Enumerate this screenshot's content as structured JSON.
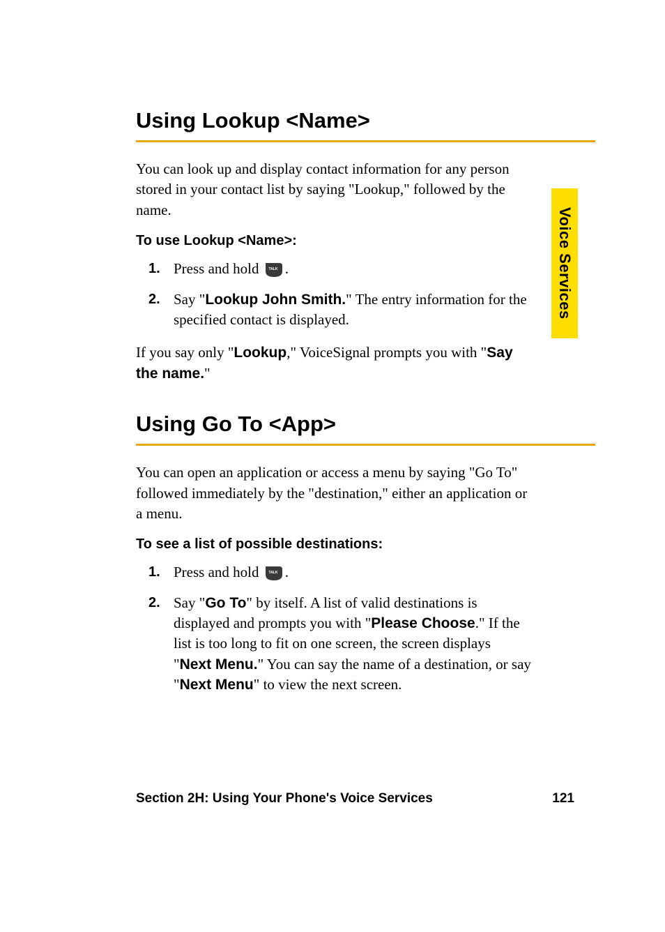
{
  "sideTab": "Voice Services",
  "sections": [
    {
      "heading": "Using Lookup <Name>",
      "intro": "You can look up and display contact information for any person stored in your contact list by saying \"Lookup,\" followed by the name.",
      "subheading": "To use Lookup <Name>:",
      "steps": {
        "step1_pre": "Press and hold ",
        "step1_post": ".",
        "step2_pre": "Say \"",
        "step2_bold": "Lookup John Smith.",
        "step2_post": "\" The entry information for the specified contact is displayed."
      },
      "after_pre": "If you say only \"",
      "after_bold1": "Lookup",
      "after_mid": ",\" VoiceSignal prompts you with \"",
      "after_bold2": "Say the name.",
      "after_post": "\""
    },
    {
      "heading": "Using Go To <App>",
      "intro": "You can open an application or access a menu by saying \"Go To\" followed immediately by the \"destination,\" either an application or a menu.",
      "subheading": "To see a list of possible destinations:",
      "steps": {
        "step1_pre": "Press and hold ",
        "step1_post": ".",
        "step2_pre": "Say \"",
        "step2_bold1": "Go To",
        "step2_mid1": "\" by itself. A list of valid destinations is displayed and prompts you with \"",
        "step2_bold2": "Please Choose",
        "step2_mid2": ".\" If the list is too long to fit on one screen, the screen displays \"",
        "step2_bold3": "Next Menu.",
        "step2_mid3": "\" You can say the name of a destination, or say \"",
        "step2_bold4": "Next Menu",
        "step2_post": "\" to view the next screen."
      }
    }
  ],
  "footer": {
    "left": "Section 2H: Using Your Phone's Voice Services",
    "pageNumber": "121"
  },
  "icons": {
    "talkKey": "TALK"
  }
}
